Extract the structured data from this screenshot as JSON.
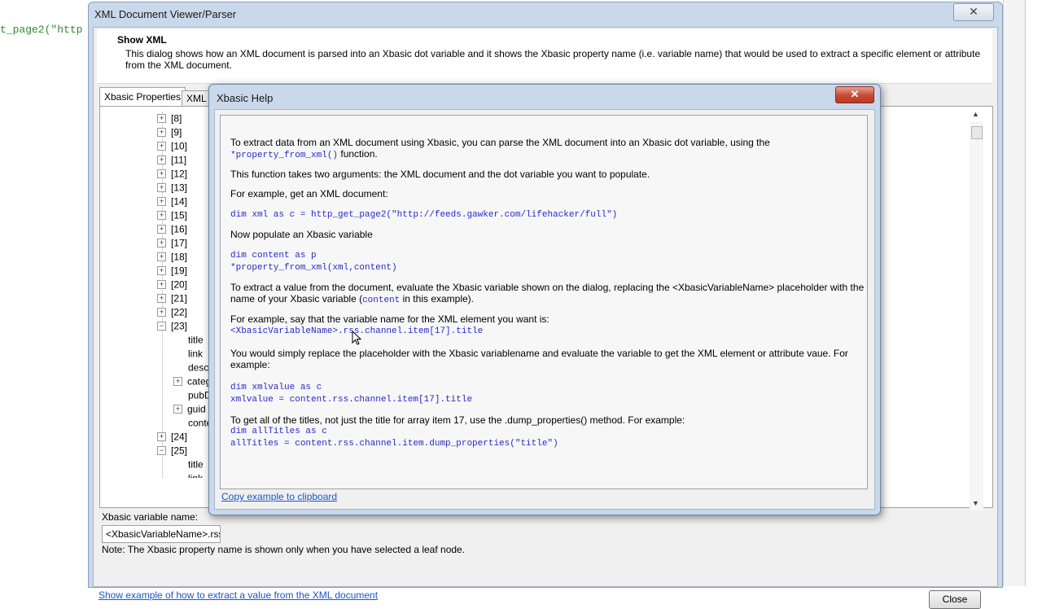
{
  "background_editor": {
    "code_snippet": "t_page2(\"http"
  },
  "parser_window": {
    "title": "XML Document Viewer/Parser",
    "close_glyph": "✕",
    "header": {
      "title": "Show XML",
      "description": "This dialog shows how an XML document is parsed into an Xbasic dot variable and it shows the Xbasic property name (i.e. variable name) that would be used to extract a specific element or attribute from the XML document."
    },
    "tabs": [
      {
        "label": "Xbasic Properties"
      },
      {
        "label": "XML"
      }
    ],
    "tree": [
      {
        "label": "[8]",
        "expander": "+"
      },
      {
        "label": "[9]",
        "expander": "+"
      },
      {
        "label": "[10]",
        "expander": "+"
      },
      {
        "label": "[11]",
        "expander": "+"
      },
      {
        "label": "[12]",
        "expander": "+"
      },
      {
        "label": "[13]",
        "expander": "+"
      },
      {
        "label": "[14]",
        "expander": "+"
      },
      {
        "label": "[15]",
        "expander": "+"
      },
      {
        "label": "[16]",
        "expander": "+"
      },
      {
        "label": "[17]",
        "expander": "+"
      },
      {
        "label": "[18]",
        "expander": "+"
      },
      {
        "label": "[19]",
        "expander": "+"
      },
      {
        "label": "[20]",
        "expander": "+"
      },
      {
        "label": "[21]",
        "expander": "+"
      },
      {
        "label": "[22]",
        "expander": "+"
      },
      {
        "label": "[23]",
        "expander": "−"
      },
      {
        "label": "title",
        "expander": ""
      },
      {
        "label": "link",
        "expander": ""
      },
      {
        "label": "descr",
        "expander": ""
      },
      {
        "label": "categ",
        "expander": "+"
      },
      {
        "label": "pubD",
        "expander": ""
      },
      {
        "label": "guid",
        "expander": "+"
      },
      {
        "label": "conte",
        "expander": ""
      },
      {
        "label": "[24]",
        "expander": "+"
      },
      {
        "label": "[25]",
        "expander": "−"
      },
      {
        "label": "title",
        "expander": ""
      },
      {
        "label": "link",
        "expander": ""
      }
    ],
    "variable_name_label": "Xbasic variable name:",
    "variable_name_value": "<XbasicVariableName>.rss",
    "note": "Note: The Xbasic property name is shown only when you have selected a leaf node.",
    "show_example_link": "Show example of how to extract a value from the XML document",
    "close_button": "Close"
  },
  "help_dialog": {
    "title": "Xbasic Help",
    "close_glyph": "✕",
    "p1_line1": "To extract data from an XML document using Xbasic, you can parse the XML document into an Xbasic dot variable, using the",
    "p1_code": "*property_from_xml()",
    "p1_tail": " function.",
    "p2": "This function takes two arguments: the XML document and the dot variable you want to populate.",
    "p3": "For example, get an XML document:",
    "code1": "dim xml as c = http_get_page2(\"http://feeds.gawker.com/lifehacker/full\")",
    "p4": "Now populate an Xbasic variable",
    "code2_line1": "dim content as p",
    "code2_line2": "*property_from_xml(xml,content)",
    "p5_line1": "To extract a value from the document, evaluate the Xbasic variable shown on the dialog, replacing the <XbasicVariableName> placeholder with the",
    "p5_line2_head": "name of your Xbasic variable (",
    "p5_line2_code": "content",
    "p5_line2_tail": " in this example).",
    "p6": "For example, say that the variable name for the XML element you want is:",
    "code3": "<XbasicVariableName>.rss.channel.item[17].title",
    "p7_line1": "You would simply replace the placeholder with the Xbasic variablename and evaluate the variable to get the XML element or attribute vaue. For",
    "p7_line2": "example:",
    "code4_line1": "dim xmlvalue as c",
    "code4_line2": "xmlvalue = content.rss.channel.item[17].title",
    "p8": "To get all of the titles, not just the title for array item 17, use the .dump_properties() method. For example:",
    "code5_line1": "dim allTitles as c",
    "code5_line2": "allTitles = content.rss.channel.item.dump_properties(\"title\")",
    "copy_link": "Copy example to clipboard"
  },
  "colors": {
    "code_blue": "#2929c8",
    "link_blue": "#1a56c4",
    "editor_green": "#2e8b2e"
  }
}
